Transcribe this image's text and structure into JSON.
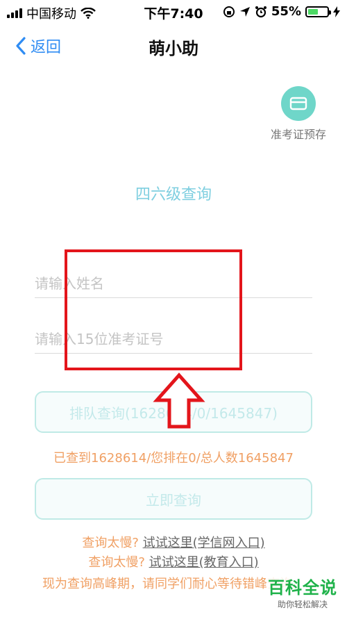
{
  "status_bar": {
    "carrier": "中国移动",
    "time": "下午7:40",
    "battery": "55%",
    "battery_level": 0.55
  },
  "nav": {
    "back_label": "返回",
    "title": "萌小助"
  },
  "ticket": {
    "label": "准考证预存"
  },
  "section_title": "四六级查询",
  "form": {
    "name_placeholder": "请输入姓名",
    "id_placeholder": "请输入15位准考证号"
  },
  "queue_button": "排队查询(1628614/0/1645847)",
  "queue_status": "已查到1628614/您排在0/总人数1645847",
  "query_button": "立即查询",
  "links": [
    {
      "prefix": "查询太慢? ",
      "link": "试试这里(学信网入口)"
    },
    {
      "prefix": "查询太慢? ",
      "link": "试试这里(教育入口)"
    }
  ],
  "notice": "现为查询高峰期，请同学们耐心等待错峰查询。",
  "watermark": {
    "main": "百科全说",
    "sub": "助你轻松解决"
  },
  "colors": {
    "accent_blue": "#2f8cf3",
    "teal": "#6fd6c9",
    "orange": "#f0a064",
    "highlight_red": "#e3151b"
  }
}
